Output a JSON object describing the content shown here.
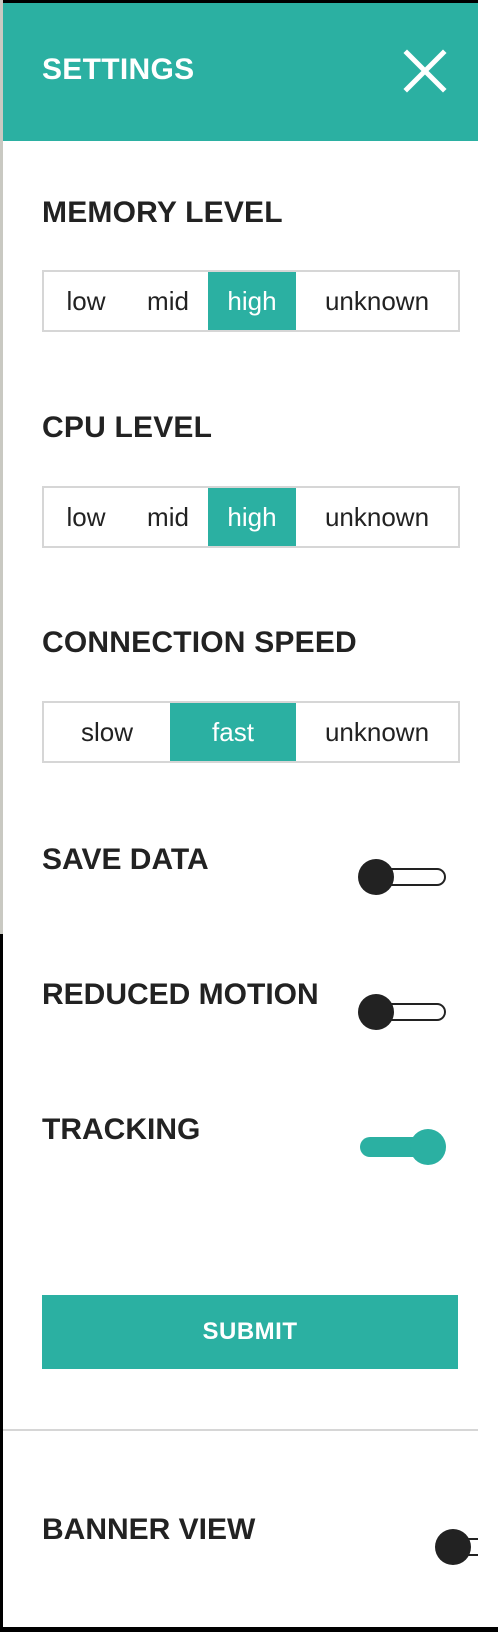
{
  "settings": {
    "title": "SETTINGS",
    "close_icon": "close-icon",
    "memory_level": {
      "label": "MEMORY LEVEL",
      "options": [
        "low",
        "mid",
        "high",
        "unknown"
      ],
      "selected": "high"
    },
    "cpu_level": {
      "label": "CPU LEVEL",
      "options": [
        "low",
        "mid",
        "high",
        "unknown"
      ],
      "selected": "high"
    },
    "connection_speed": {
      "label": "CONNECTION SPEED",
      "options": [
        "slow",
        "fast",
        "unknown"
      ],
      "selected": "fast"
    },
    "save_data": {
      "label": "SAVE DATA",
      "on": false
    },
    "reduced_motion": {
      "label": "REDUCED MOTION",
      "on": false
    },
    "tracking": {
      "label": "TRACKING",
      "on": true
    },
    "submit_label": "SUBMIT",
    "banner_view": {
      "label": "BANNER VIEW",
      "on": false
    }
  },
  "colors": {
    "accent": "#2bb0a2",
    "text": "#222222",
    "border": "#d6d6d6"
  }
}
